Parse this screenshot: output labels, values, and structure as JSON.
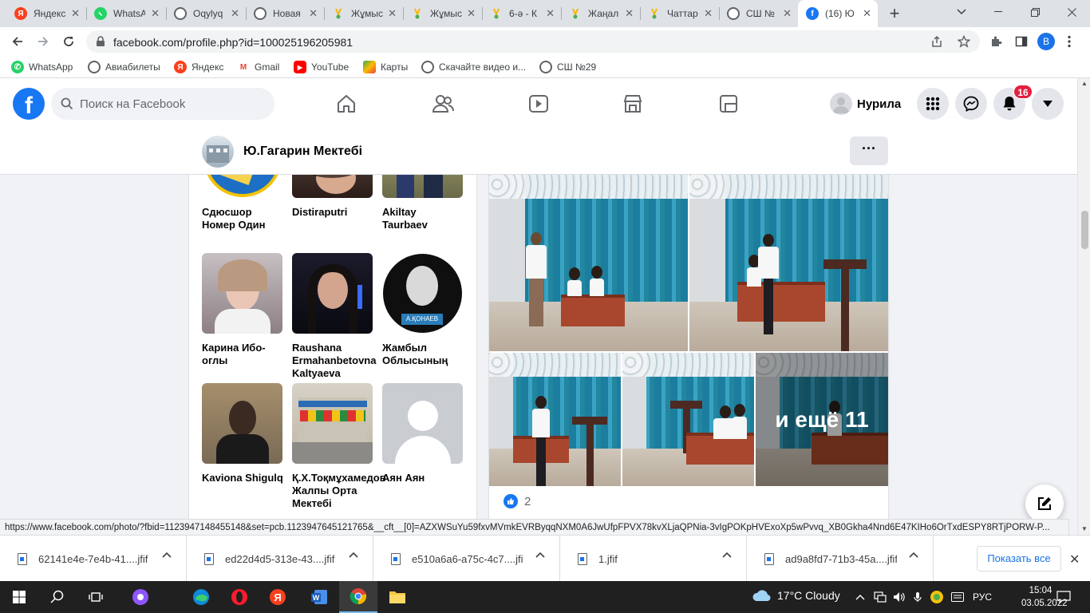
{
  "browser": {
    "tabs": [
      {
        "label": "Яндекс",
        "icon": "yandex-icon",
        "color": "#fc3f1d",
        "glyph": "Я"
      },
      {
        "label": "WhatsApp",
        "icon": "whatsapp-icon",
        "color": "#25d366",
        "glyph": ""
      },
      {
        "label": "Oqylyq",
        "icon": "globe-icon",
        "color": "#5f6368",
        "glyph": ""
      },
      {
        "label": "Новая",
        "icon": "globe-icon",
        "color": "#5f6368",
        "glyph": ""
      },
      {
        "label": "Жұмыс",
        "icon": "kundelik-icon",
        "color": "#f6b600",
        "glyph": ""
      },
      {
        "label": "Жұмыс",
        "icon": "kundelik-icon",
        "color": "#f6b600",
        "glyph": ""
      },
      {
        "label": "6-ә - К",
        "icon": "kundelik-icon",
        "color": "#f6b600",
        "glyph": ""
      },
      {
        "label": "Жаңал",
        "icon": "kundelik-icon",
        "color": "#f6b600",
        "glyph": ""
      },
      {
        "label": "Чаттар",
        "icon": "kundelik-icon",
        "color": "#f6b600",
        "glyph": ""
      },
      {
        "label": "СШ №",
        "icon": "globe-icon",
        "color": "#5f6368",
        "glyph": ""
      },
      {
        "label": "(16) Ю",
        "icon": "facebook-icon",
        "color": "#1877f2",
        "glyph": "f"
      }
    ],
    "url": "facebook.com/profile.php?id=100025196205981",
    "profile_initial": "B",
    "bookmarks": [
      {
        "label": "WhatsApp",
        "icon": "whatsapp-icon",
        "color": "#25d366",
        "glyph": ""
      },
      {
        "label": "Авиабилеты",
        "icon": "globe-icon",
        "color": "#5f6368",
        "glyph": ""
      },
      {
        "label": "Яндекс",
        "icon": "yandex-icon",
        "color": "#fc3f1d",
        "glyph": "Я"
      },
      {
        "label": "Gmail",
        "icon": "gmail-icon",
        "color": "#ea4335",
        "glyph": "M"
      },
      {
        "label": "YouTube",
        "icon": "youtube-icon",
        "color": "#ff0000",
        "glyph": "▶"
      },
      {
        "label": "Карты",
        "icon": "maps-icon",
        "color": "#34a853",
        "glyph": ""
      },
      {
        "label": "Скачайте видео и...",
        "icon": "globe-icon",
        "color": "#5f6368",
        "glyph": ""
      },
      {
        "label": "СШ №29",
        "icon": "globe-icon",
        "color": "#5f6368",
        "glyph": ""
      }
    ],
    "status_url": "https://www.facebook.com/photo/?fbid=1123947148455148&set=pcb.1123947645121765&__cft__[0]=AZXWSuYu59fxvMVmkEVRByqqNXM0A6JwUfpFPVX78kvXLjaQPNia-3vIgPOKpHVExoXp5wPvvq_XB0Gkha4Nnd6E47KIHo6OrTxdESPY8RTjPORW-P..."
  },
  "facebook": {
    "search_placeholder": "Поиск на Facebook",
    "user_name": "Нурила",
    "notifications_count": "16",
    "page_name": "Ю.Гагарин Мектебі",
    "more_label": "···",
    "friends": [
      {
        "name": "Сдюсшор Номер Один"
      },
      {
        "name": "Distiraputri"
      },
      {
        "name": "Akiltay Taurbaev"
      },
      {
        "name": "Карина Ибо-оглы"
      },
      {
        "name": "Raushana Ermahanbetovna Kaltyaeva"
      },
      {
        "name": "Жамбыл Облысының"
      },
      {
        "name": "Kaviona Shigulq"
      },
      {
        "name": "Қ.Х.Тоқмұхамедов Жалпы Орта Мектебі"
      },
      {
        "name": "Аян Аян"
      }
    ],
    "post": {
      "more_photos_label": "и ещё 11",
      "likes": "2"
    }
  },
  "downloads": {
    "items": [
      {
        "name": "62141e4e-7e4b-41....jfif"
      },
      {
        "name": "ed22d4d5-313e-43....jfif"
      },
      {
        "name": "e510a6a6-a75c-4c7....jfif"
      },
      {
        "name": "1.jfif"
      },
      {
        "name": "ad9a8fd7-71b3-45a....jfif"
      }
    ],
    "show_all_label": "Показать все"
  },
  "taskbar": {
    "weather": "17°C  Cloudy",
    "language": "РУС",
    "time": "15:04",
    "date": "03.05.2022"
  }
}
